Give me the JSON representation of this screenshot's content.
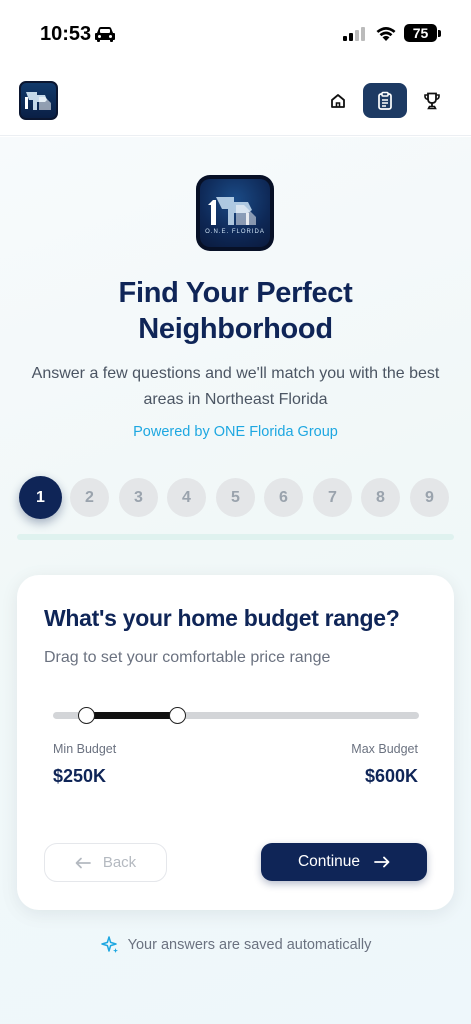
{
  "status_bar": {
    "time": "10:53",
    "battery": "75"
  },
  "logo": {
    "mark": "1FL",
    "tagline": "O.N.E. FLORIDA"
  },
  "header": {
    "nav": [
      {
        "name": "home",
        "icon": "home-icon"
      },
      {
        "name": "quiz",
        "icon": "clipboard-icon",
        "active": true
      },
      {
        "name": "achievements",
        "icon": "trophy-icon"
      }
    ]
  },
  "hero": {
    "title_line1": "Find Your Perfect",
    "title_line2": "Neighborhood",
    "subtitle": "Answer a few questions and we'll match you with the best areas in Northeast Florida",
    "powered_by": "Powered by ONE Florida Group"
  },
  "steps": {
    "current": 1,
    "total": 9,
    "labels": [
      "1",
      "2",
      "3",
      "4",
      "5",
      "6",
      "7",
      "8",
      "9"
    ]
  },
  "question": {
    "title": "What's your home budget range?",
    "subtitle": "Drag to set your comfortable price range",
    "slider": {
      "min_fraction": 0.09,
      "max_fraction": 0.34
    },
    "min_label": "Min Budget",
    "min_value": "$250K",
    "max_label": "Max Budget",
    "max_value": "$600K"
  },
  "actions": {
    "back_label": "Back",
    "continue_label": "Continue"
  },
  "footer": {
    "autosave_text": "Your answers are saved automatically"
  },
  "colors": {
    "primary": "#0f2557",
    "accent": "#1ea7e1",
    "progress_track": "#dff2ef"
  }
}
